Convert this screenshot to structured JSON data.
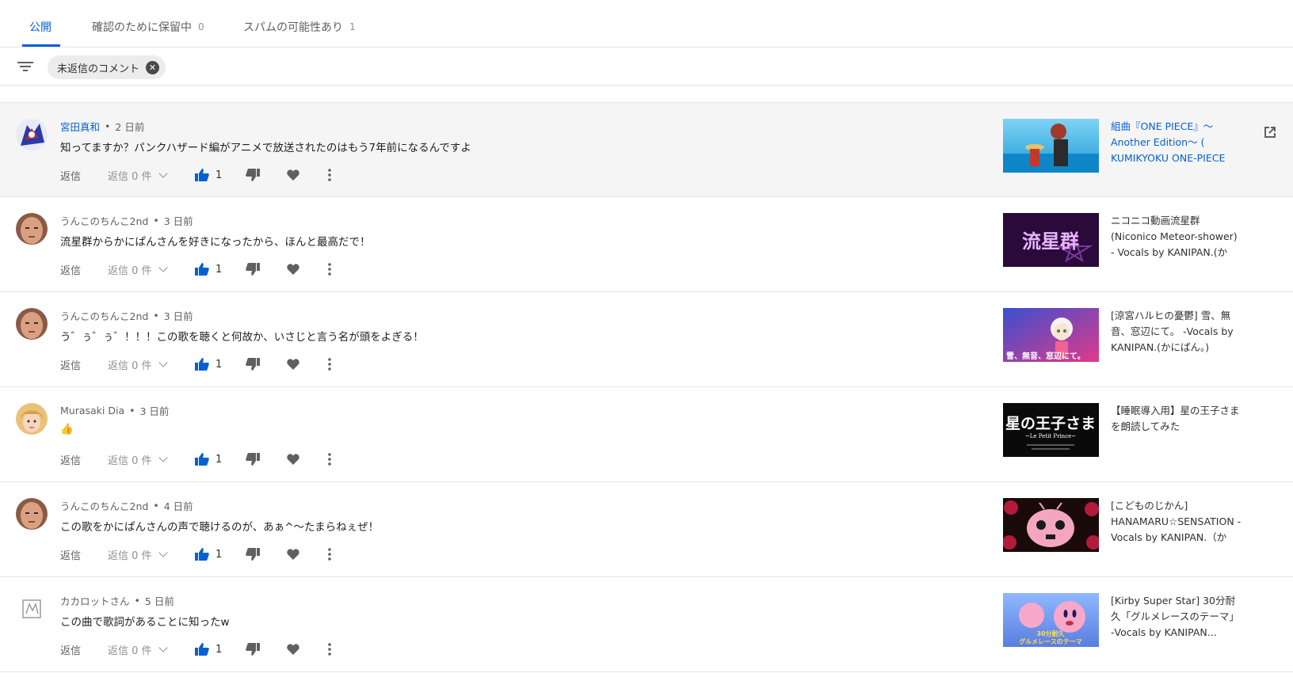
{
  "tabs": [
    {
      "label": "公開",
      "count": "",
      "active": true
    },
    {
      "label": "確認のために保留中",
      "count": "0",
      "active": false
    },
    {
      "label": "スパムの可能性あり",
      "count": "1",
      "active": false
    }
  ],
  "filter": {
    "chip_label": "未返信のコメント"
  },
  "colors": {
    "accent": "#065fd4",
    "hover_row": "#f5f5f5",
    "divider": "#e5e5e5"
  },
  "comments": [
    {
      "author": "宮田真和",
      "time": "2 日前",
      "text": "知ってますか？パンクハザード編がアニメで放送されたのはもう7年前になるんですよ",
      "reply": "返信",
      "replies": "返信 0 件",
      "likes": "1",
      "video_title": "組曲『ONE PIECE』〜Another Edition〜 ( KUMIKYOKU ONE-PIECE K...",
      "author_link": true,
      "hover": true
    },
    {
      "author": "うんこのちんこ2nd",
      "time": "3 日前",
      "text": "流星群からかにぱんさんを好きになったから、ほんと最高だで！",
      "reply": "返信",
      "replies": "返信 0 件",
      "likes": "1",
      "video_title": "ニコニコ動画流星群 (Niconico Meteor-shower) - Vocals by KANIPAN.(かに..."
    },
    {
      "author": "うんこのちんこ2nd",
      "time": "3 日前",
      "text": "う゛ぅ゛ぅ゛！！！この歌を聴くと何故か、いさじと言う名が頭をよぎる！",
      "reply": "返信",
      "replies": "返信 0 件",
      "likes": "1",
      "video_title": "[涼宮ハルヒの憂鬱] 雪、無音、窓辺にて。 -Vocals by KANIPAN.(かにぱん。)"
    },
    {
      "author": "Murasaki Dia",
      "time": "3 日前",
      "text": "👍",
      "reply": "返信",
      "replies": "返信 0 件",
      "likes": "1",
      "video_title": "【睡眠導入用】星の王子さまを朗読してみた"
    },
    {
      "author": "うんこのちんこ2nd",
      "time": "4 日前",
      "text": "この歌をかにぱんさんの声で聴けるのが、あぁ^〜たまらねぇぜ！",
      "reply": "返信",
      "replies": "返信 0 件",
      "likes": "1",
      "video_title": "[こどものじかん] HANAMARU☆SENSATION - Vocals by KANIPAN.（かに..."
    },
    {
      "author": "カカロットさん",
      "time": "5 日前",
      "text": "この曲で歌詞があることに知ったw",
      "reply": "返信",
      "replies": "返信 0 件",
      "likes": "1",
      "video_title": "[Kirby Super Star] 30分耐久「グルメレースのテーマ」 -Vocals by KANIPAN..."
    }
  ],
  "thumbnails": [
    {
      "caption": ""
    },
    {
      "caption": "流星群"
    },
    {
      "caption": "雪、無音、窓辺にて。"
    },
    {
      "caption": "星の王子さま",
      "sub": "~Le Petit Prince~"
    },
    {
      "caption": ""
    },
    {
      "caption": "30分耐久",
      "sub": "グルメレースのテーマ"
    }
  ]
}
